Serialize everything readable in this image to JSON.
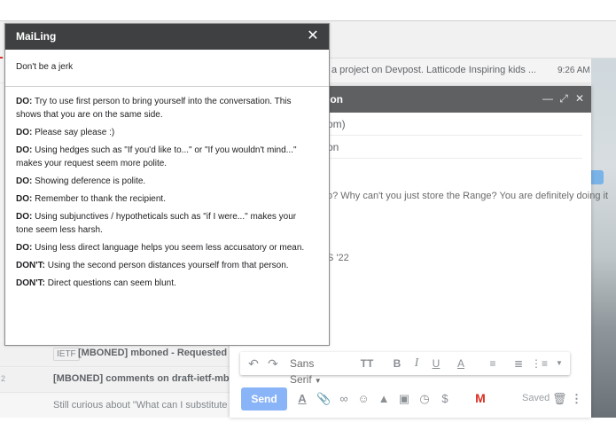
{
  "gmail": {
    "rows": [
      {
        "snippet": "a project on Devpost. Latticode Inspiring kids ...",
        "time": "9:26 AM"
      },
      {
        "label": "IETF",
        "subject": "[MBONED] mboned - Requested sess"
      },
      {
        "count": "2",
        "subject": "[MBONED] comments on draft-ietf-mboned"
      },
      {
        "subject": "Still curious about \"What can I substitute fo"
      }
    ]
  },
  "compose": {
    "title": "ion",
    "to": "om)",
    "subject": "on",
    "body_line1": "o? Why can't you just store the Range? You are definitely doing it",
    "body_line2": "S '22",
    "toolbar": {
      "font": "Sans Serif"
    },
    "send_label": "Send",
    "saved_label": "Saved",
    "icons": [
      "undo-icon",
      "redo-icon",
      "text-size-icon",
      "bold-icon",
      "italic-icon",
      "underline-icon",
      "text-color-icon",
      "align-icon",
      "numbered-list-icon",
      "bulleted-list-icon",
      "attach-icon",
      "link-icon",
      "emoji-icon",
      "drive-icon",
      "photo-icon",
      "lock-clock-icon",
      "dollar-icon",
      "gmail-icon",
      "trash-icon",
      "more-vert-icon"
    ]
  },
  "mailing": {
    "title": "MaiLing",
    "input_text": "Don't be a jerk",
    "tips": [
      {
        "kind": "DO:",
        "text": "Try to use first person to bring yourself into the conversation. This shows that you are on the same side."
      },
      {
        "kind": "DO:",
        "text": "Please say please :)"
      },
      {
        "kind": "DO:",
        "text": "Using hedges such as \"If you'd like to...\" or \"If you wouldn't mind...\" makes your request seem more polite."
      },
      {
        "kind": "DO:",
        "text": "Showing deference is polite."
      },
      {
        "kind": "DO:",
        "text": "Remember to thank the recipient."
      },
      {
        "kind": "DO:",
        "text": "Using subjunctives / hypotheticals such as \"if I were...\" makes your tone seem less harsh."
      },
      {
        "kind": "DO:",
        "text": "Using less direct language helps you seem less accusatory or mean."
      },
      {
        "kind": "DON'T:",
        "text": "Using the second person distances yourself from that person."
      },
      {
        "kind": "DON'T:",
        "text": "Direct questions can seem blunt."
      }
    ]
  },
  "colors": {
    "mailing_header": "#3f4042",
    "compose_header": "#5f6062",
    "send_button": "#8ab4f8",
    "gmail_red": "#d93025"
  }
}
